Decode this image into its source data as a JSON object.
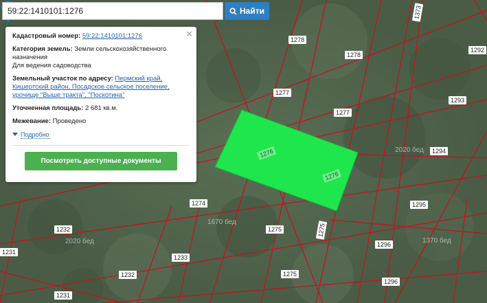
{
  "search": {
    "value": "59:22:1410101:1276",
    "button_label": "Найти",
    "button_icon": "search-icon"
  },
  "popup": {
    "cadastral_label": "Кадастровый номер:",
    "cadastral_value": "59:22:1410101:1276",
    "category_label": "Категория земель:",
    "category_value": "Земли сельскохозяйственного назначения",
    "usage": "Для ведения садоводства",
    "address_label": "Земельный участок по адресу:",
    "address_value": "Пермский край, Кишертский район, Посадское сельское поселение, урочище \"Выше тракта\", \"Поскотина\"",
    "area_label": "Уточненная площадь:",
    "area_value": "2 681 кв.м.",
    "survey_label": "Межевание:",
    "survey_value": "Проведено",
    "details_link": "Подробно",
    "docs_button": "Посмотреть доступные документы"
  },
  "map": {
    "labels": [
      "1278",
      "1278",
      "1292",
      "1277",
      "1277",
      "1293",
      "1276",
      "1276",
      "1294",
      "1274",
      "1295",
      "1232",
      "1275",
      "1275",
      "1296",
      "1231",
      "1233",
      "1232",
      "1275",
      "1296",
      "1231",
      "1373"
    ],
    "faint_labels": [
      "1670 бед",
      "2020 бед",
      "2020 бед",
      "1370 бед"
    ],
    "highlight_color": "#1fe64c",
    "boundary_color": "#c0161d"
  }
}
